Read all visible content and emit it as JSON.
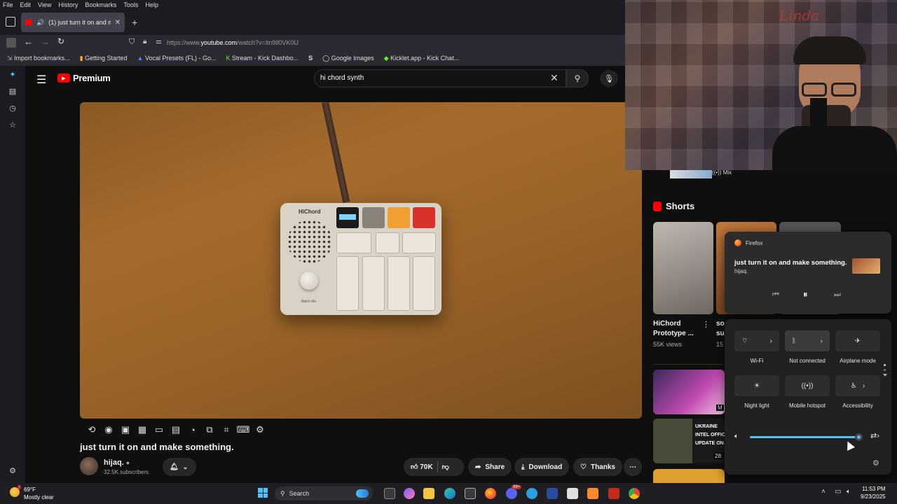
{
  "menu": [
    "File",
    "Edit",
    "View",
    "History",
    "Bookmarks",
    "Tools",
    "Help"
  ],
  "tab": {
    "title": "(1) just turn it on and make"
  },
  "url": {
    "prefix": "https://www.",
    "domain": "youtube.com",
    "path": "/watch?v=ltn9ll0VK0U"
  },
  "bookmarks": [
    "Import bookmarks...",
    "Getting Started",
    "Vocal Presets (FL) - Go...",
    "Stream - Kick Dashbo...",
    "Google Images",
    "Kicklet.app - Kick Chat..."
  ],
  "youtube": {
    "brand": "Premium",
    "search_value": "hi chord synth",
    "device_label": "HiChord",
    "knob_label": "Batch Me",
    "video_title": "just turn it on and make something.",
    "channel": {
      "name": "hijaq.",
      "subs": "32.5K subscribers"
    },
    "likes": "70K",
    "share": "Share",
    "download": "Download",
    "thanks": "Thanks",
    "mix_label": "Mix"
  },
  "shorts": {
    "heading": "Shorts",
    "item1": {
      "title_line1": "HiChord",
      "title_line2": "Prototype ...",
      "views": "55K views"
    },
    "item2": {
      "title_line1": "so",
      "title_line2": "su",
      "views": "15"
    }
  },
  "sidebar_thumbs": {
    "time1": "M",
    "news": [
      "UKRAINE",
      "INTEL OFFICI",
      "UPDATE ON U"
    ],
    "time2": "28:"
  },
  "media_flyout": {
    "app": "Firefox",
    "title": "just turn it on and make something.",
    "artist": "hijaq."
  },
  "quick_settings": {
    "tiles": [
      {
        "label": "Wi-Fi"
      },
      {
        "label": "Not connected"
      },
      {
        "label": "Airplane mode"
      },
      {
        "label": "Night light"
      },
      {
        "label": "Mobile hotspot"
      },
      {
        "label": "Accessibility"
      }
    ],
    "volume_percent": 100
  },
  "taskbar": {
    "weather_temp": "69°F",
    "weather_desc": "Mostly clear",
    "search": "Search",
    "time": "11:53 PM",
    "date": "9/23/2025",
    "badge": "99+"
  },
  "colors": {
    "yt_red": "#ff0000",
    "accent_blue": "#4cc2ff",
    "panel": "#202020"
  }
}
